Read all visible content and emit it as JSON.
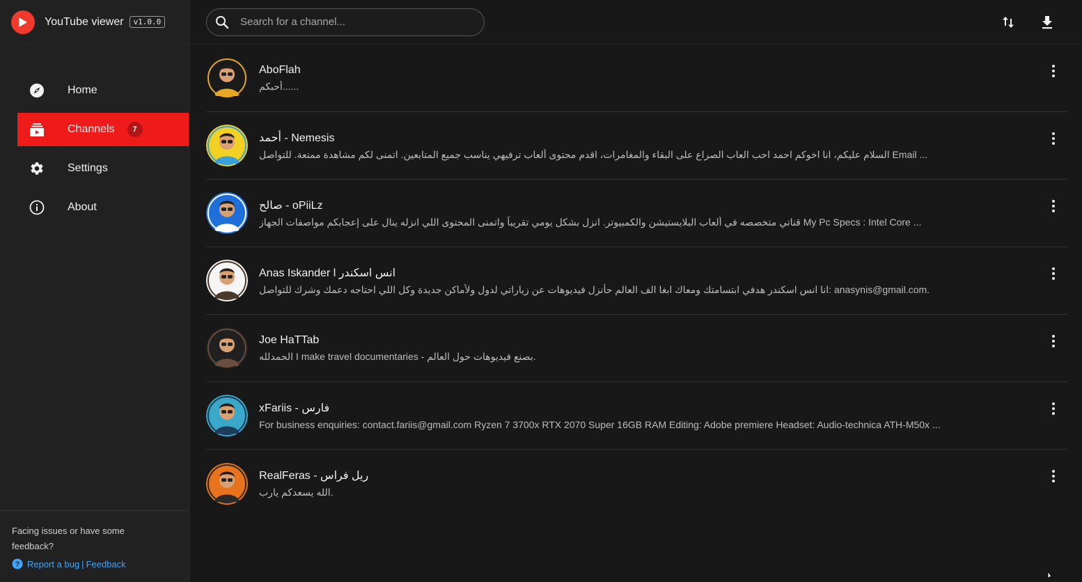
{
  "app": {
    "title": "YouTube viewer",
    "version": "v1.0.0",
    "accent": "#ef1b1b"
  },
  "nav": {
    "home": "Home",
    "channels": "Channels",
    "channels_badge": "7",
    "settings": "Settings",
    "about": "About"
  },
  "footer": {
    "text": "Facing issues or have some feedback?",
    "report_bug": "Report a bug",
    "separator": "|",
    "feedback": "Feedback"
  },
  "search": {
    "placeholder": "Search for a channel..."
  },
  "channels": [
    {
      "title": "AboFlah",
      "desc": "أحبكم......",
      "avatar_colors": [
        "#1a1a1a",
        "#e6a823"
      ]
    },
    {
      "title": "أحمد - Nemesis",
      "desc": "السلام عليكم، انا اخوكم احمد احب العاب الصراع على البقاء والمغامرات، اقدم محتوى ألعاب ترفيهي يناسب جميع المتابعين. اتمنى لكم مشاهدة ممتعة. للتواصل Email ...",
      "avatar_colors": [
        "#f2d024",
        "#3aa0d8"
      ]
    },
    {
      "title": "صالح - oPiiLz",
      "desc": "قناتي متخصصه في ألعاب البلايستيشن والكمبيوتر. انزل بشكل يومي تقريباً واتمنى المحتوى اللي انزله ينال على إعجابكم مواصفات الجهاز My Pc Specs : Intel Core ...",
      "avatar_colors": [
        "#1e6fd9",
        "#ffffff"
      ]
    },
    {
      "title": "Anas Iskander l انس اسكندر",
      "desc": "انا انس اسكندر هدفي ابتسامتك ومعاك ابغا الف العالم حأنزل فيديوهات عن زياراتي لدول ولأماكن جديدة وكل اللي احتاجه دعمك وشرك للتواصل: anasynis@gmail.com.",
      "avatar_colors": [
        "#f5f5f5",
        "#4a3a2a"
      ]
    },
    {
      "title": "Joe HaTTab",
      "desc": "الحمدلله I make travel documentaries - بصنع فيديوهات حول العالم.",
      "avatar_colors": [
        "#202020",
        "#6b4e3d"
      ]
    },
    {
      "title": "xFariis - فارس",
      "desc": "For business enquiries: contact.fariis@gmail.com Ryzen 7 3700x RTX 2070 Super 16GB RAM Editing: Adobe premiere Headset: Audio-technica ATH-M50x ...",
      "avatar_colors": [
        "#3aa8c8",
        "#1d3d5a"
      ]
    },
    {
      "title": "RealFeras - ريل فراس",
      "desc": "الله يسعدكم يارب.",
      "avatar_colors": [
        "#e8731c",
        "#2a2a2a"
      ]
    }
  ]
}
